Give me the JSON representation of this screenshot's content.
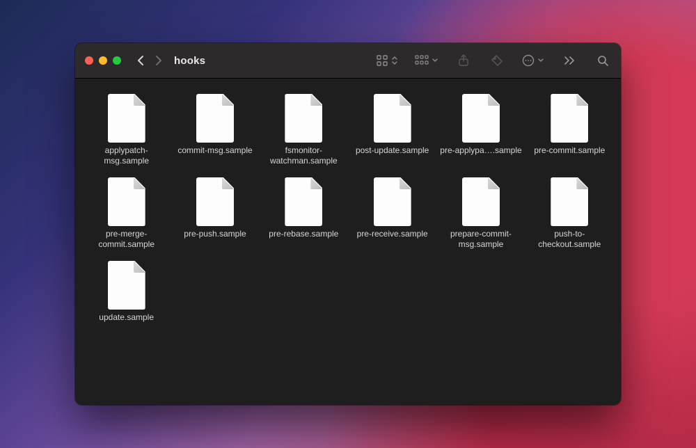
{
  "window": {
    "title": "hooks"
  },
  "files": [
    {
      "name": "applypatch-msg.sample"
    },
    {
      "name": "commit-msg.sample"
    },
    {
      "name": "fsmonitor-watchman.sample"
    },
    {
      "name": "post-update.sample"
    },
    {
      "name": "pre-applypa….sample"
    },
    {
      "name": "pre-commit.sample"
    },
    {
      "name": "pre-merge-commit.sample"
    },
    {
      "name": "pre-push.sample"
    },
    {
      "name": "pre-rebase.sample"
    },
    {
      "name": "pre-receive.sample"
    },
    {
      "name": "prepare-commit-msg.sample"
    },
    {
      "name": "push-to-checkout.sample"
    },
    {
      "name": "update.sample"
    }
  ]
}
